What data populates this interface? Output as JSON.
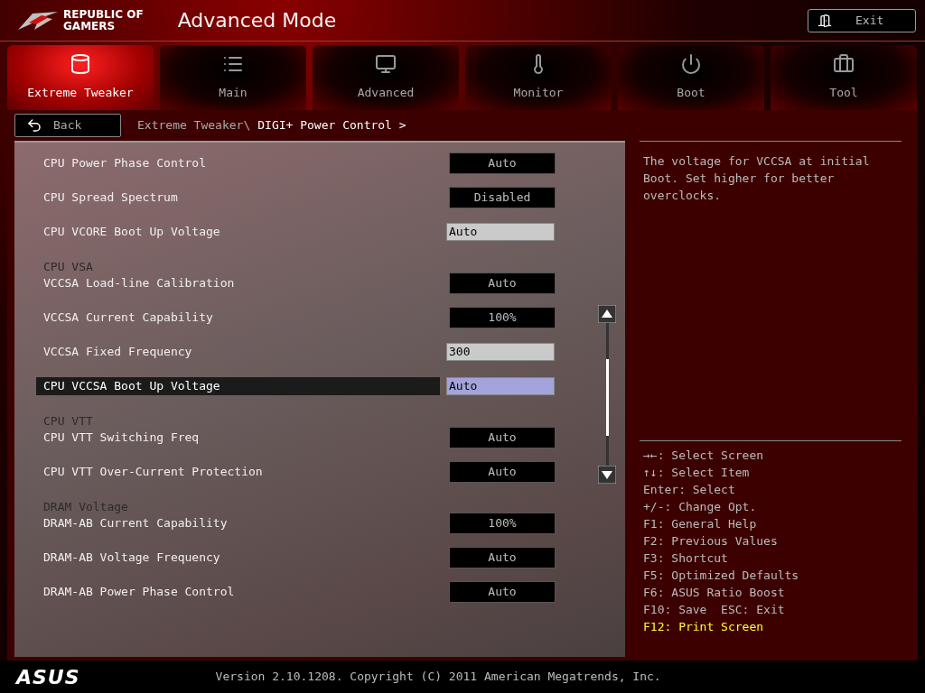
{
  "brand": {
    "line1": "REPUBLIC OF",
    "line2": "GAMERS"
  },
  "window": {
    "title": "Advanced Mode"
  },
  "exit_button": {
    "label": "Exit"
  },
  "tabs": [
    {
      "label": "Extreme Tweaker",
      "selected": true
    },
    {
      "label": "Main",
      "selected": false
    },
    {
      "label": "Advanced",
      "selected": false
    },
    {
      "label": "Monitor",
      "selected": false
    },
    {
      "label": "Boot",
      "selected": false
    },
    {
      "label": "Tool",
      "selected": false
    }
  ],
  "back_button": {
    "label": "Back"
  },
  "breadcrumb": {
    "parent": "Extreme Tweaker\\",
    "current": "DIGI+ Power Control >"
  },
  "settings": [
    {
      "kind": "select",
      "label": "CPU Power Phase Control",
      "value": "Auto",
      "selected": false
    },
    {
      "kind": "select",
      "label": "CPU Spread Spectrum",
      "value": "Disabled",
      "selected": false
    },
    {
      "kind": "input",
      "label": "CPU VCORE Boot Up Voltage",
      "value": "Auto",
      "selected": false
    },
    {
      "kind": "heading",
      "label": "CPU VSA"
    },
    {
      "kind": "select",
      "label": "VCCSA Load-line Calibration",
      "value": "Auto",
      "selected": false
    },
    {
      "kind": "select",
      "label": "VCCSA Current Capability",
      "value": "100%",
      "selected": false
    },
    {
      "kind": "input",
      "label": "VCCSA Fixed Frequency",
      "value": "300",
      "selected": false
    },
    {
      "kind": "input",
      "label": "CPU VCCSA Boot Up Voltage",
      "value": "Auto",
      "selected": true
    },
    {
      "kind": "heading",
      "label": "CPU VTT"
    },
    {
      "kind": "select",
      "label": "CPU VTT Switching Freq",
      "value": "Auto",
      "selected": false
    },
    {
      "kind": "select",
      "label": "CPU VTT Over-Current Protection",
      "value": "Auto",
      "selected": false
    },
    {
      "kind": "heading",
      "label": "DRAM Voltage"
    },
    {
      "kind": "select",
      "label": "DRAM-AB Current Capability",
      "value": "100%",
      "selected": false
    },
    {
      "kind": "select",
      "label": "DRAM-AB Voltage Frequency",
      "value": "Auto",
      "selected": false
    },
    {
      "kind": "select",
      "label": "DRAM-AB Power Phase Control",
      "value": "Auto",
      "selected": false
    }
  ],
  "help": {
    "description": "The voltage for VCCSA at initial Boot. Set higher for better overclocks.",
    "keys": [
      {
        "text": "→←: Select Screen",
        "highlight": false
      },
      {
        "text": "↑↓: Select Item",
        "highlight": false
      },
      {
        "text": "Enter: Select",
        "highlight": false
      },
      {
        "text": "+/-: Change Opt.",
        "highlight": false
      },
      {
        "text": "F1: General Help",
        "highlight": false
      },
      {
        "text": "F2: Previous Values",
        "highlight": false
      },
      {
        "text": "F3: Shortcut",
        "highlight": false
      },
      {
        "text": "F5: Optimized Defaults",
        "highlight": false
      },
      {
        "text": "F6: ASUS Ratio Boost",
        "highlight": false
      },
      {
        "text": "F10: Save  ESC: Exit",
        "highlight": false
      },
      {
        "text": "F12: Print Screen",
        "highlight": true
      }
    ]
  },
  "footer": {
    "logo": "ASUS",
    "version": "Version 2.10.1208. Copyright (C) 2011 American Megatrends, Inc."
  }
}
